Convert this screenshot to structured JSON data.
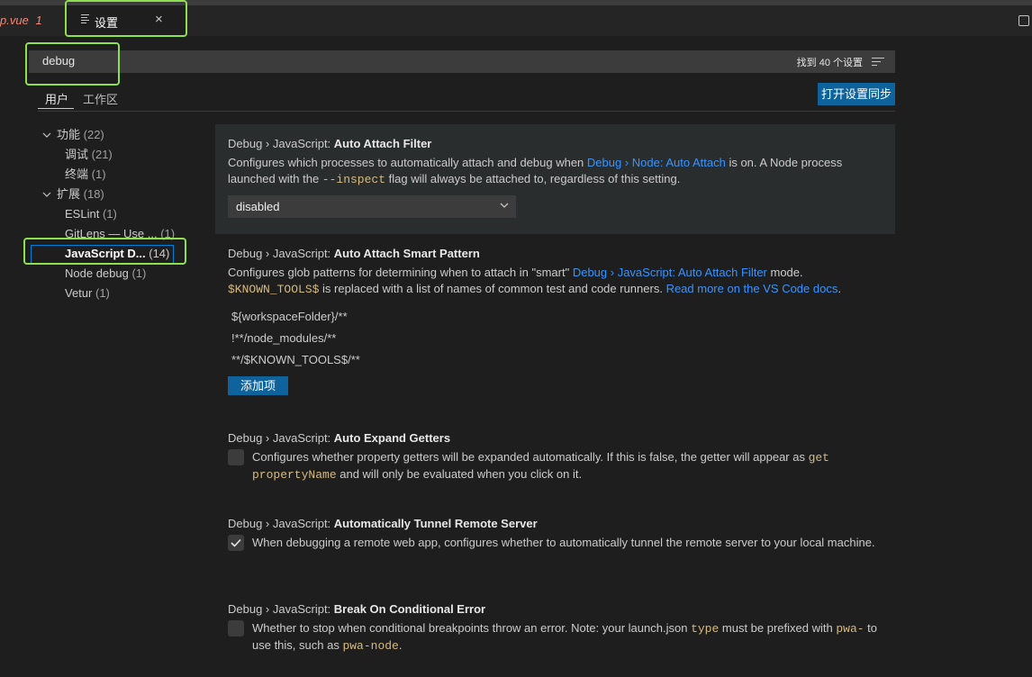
{
  "tabs": {
    "previous": {
      "name": "p.vue",
      "badge": "1"
    },
    "active": {
      "label": "设置",
      "close": "×"
    }
  },
  "search": {
    "value": "debug",
    "result_count": "找到 40 个设置"
  },
  "scope_tabs": [
    {
      "label": "用户",
      "active": true
    },
    {
      "label": "工作区",
      "active": false
    }
  ],
  "sync_button": "打开设置同步",
  "toc": [
    {
      "label": "功能",
      "count": "(22)",
      "expanded": true,
      "selected": false
    },
    {
      "label": "调试",
      "count": "(21)",
      "selected": false
    },
    {
      "label": "终端",
      "count": "(1)",
      "selected": false
    },
    {
      "label": "扩展",
      "count": "(18)",
      "expanded": true,
      "selected": false
    },
    {
      "label": "ESLint",
      "count": "(1)",
      "selected": false
    },
    {
      "label": "GitLens — Use ...",
      "count": "(1)",
      "selected": false
    },
    {
      "label": "JavaScript D...",
      "count": "(14)",
      "selected": true
    },
    {
      "label": "Node debug",
      "count": "(1)",
      "selected": false
    },
    {
      "label": "Vetur",
      "count": "(1)",
      "selected": false
    }
  ],
  "settings": {
    "auto_attach_filter": {
      "category": "Debug › JavaScript: ",
      "name": "Auto Attach Filter",
      "desc_1": "Configures which processes to automatically attach and debug when ",
      "desc_link": "Debug › Node: Auto Attach",
      "desc_2": " is on. A Node process launched with the ",
      "desc_code": "--inspect",
      "desc_3": " flag will always be attached to, regardless of this setting.",
      "select_value": "disabled"
    },
    "auto_attach_smart_pattern": {
      "category": "Debug › JavaScript: ",
      "name": "Auto Attach Smart Pattern",
      "desc_1": "Configures glob patterns for determining when to attach in \"smart\" ",
      "desc_link": "Debug › JavaScript: Auto Attach Filter",
      "desc_2": " mode. ",
      "desc_code": "$KNOWN_TOOLS$",
      "desc_3": " is replaced with a list of names of common test and code runners. ",
      "desc_link2": "Read more on the VS Code docs",
      "desc_4": ".",
      "patterns": [
        "${workspaceFolder}/**",
        "!**/node_modules/**",
        "**/$KNOWN_TOOLS$/**"
      ],
      "add_button": "添加项"
    },
    "auto_expand_getters": {
      "category": "Debug › JavaScript: ",
      "name": "Auto Expand Getters",
      "checked": false,
      "desc_1": "Configures whether property getters will be expanded automatically. If this is false, the getter will appear as ",
      "desc_code": "get propertyName",
      "desc_2": " and will only be evaluated when you click on it."
    },
    "auto_tunnel": {
      "category": "Debug › JavaScript: ",
      "name": "Automatically Tunnel Remote Server",
      "checked": true,
      "desc": "When debugging a remote web app, configures whether to automatically tunnel the remote server to your local machine."
    },
    "break_on_conditional_error": {
      "category": "Debug › JavaScript: ",
      "name": "Break On Conditional Error",
      "checked": false,
      "desc_1": "Whether to stop when conditional breakpoints throw an error. Note: your launch.json ",
      "desc_code": "type",
      "desc_2": " must be prefixed with ",
      "desc_code2": "pwa-",
      "desc_3": " to use this, such as ",
      "desc_code3": "pwa-node",
      "desc_4": "."
    }
  },
  "colors": {
    "accent": "#0e639c",
    "link": "#3794ff",
    "highlight_box": "#8ee04f",
    "code": "#d7ba7d",
    "error_tab": "#f48771"
  },
  "icons": [
    "settings-file-icon",
    "close-icon",
    "split-editor-icon",
    "clear-filter-icon",
    "chevron-down-icon",
    "checkmark-icon"
  ]
}
